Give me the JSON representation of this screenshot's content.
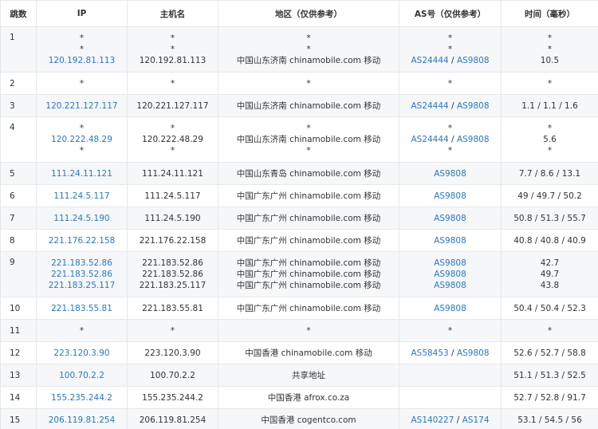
{
  "headers": {
    "hop": "跳数",
    "ip": "IP",
    "host": "主机名",
    "region": "地区（仅供参考）",
    "as": "AS号（仅供参考）",
    "time": "时间（毫秒）"
  },
  "rows": [
    {
      "hop": "1",
      "ip": [
        "*",
        "*",
        "120.192.81.113"
      ],
      "host": [
        "*",
        "*",
        "120.192.81.113"
      ],
      "region": [
        "*",
        "*",
        "中国山东济南 chinamobile.com 移动"
      ],
      "as": [
        [
          "*"
        ],
        [
          "*"
        ],
        [
          "AS24444",
          "AS9808"
        ]
      ],
      "time": [
        "*",
        "*",
        "10.5"
      ]
    },
    {
      "hop": "2",
      "ip": [
        "*"
      ],
      "host": [
        "*"
      ],
      "region": [
        "*"
      ],
      "as": [
        [
          "*"
        ]
      ],
      "time": [
        "*"
      ]
    },
    {
      "hop": "3",
      "ip": [
        "120.221.127.117"
      ],
      "host": [
        "120.221.127.117"
      ],
      "region": [
        "中国山东济南 chinamobile.com 移动"
      ],
      "as": [
        [
          "AS24444",
          "AS9808"
        ]
      ],
      "time": [
        "1.1 / 1.1 / 1.6"
      ]
    },
    {
      "hop": "4",
      "ip": [
        "*",
        "120.222.48.29",
        "*"
      ],
      "host": [
        "*",
        "120.222.48.29",
        "*"
      ],
      "region": [
        "*",
        "中国山东济南 chinamobile.com 移动",
        "*"
      ],
      "as": [
        [
          "*"
        ],
        [
          "AS24444",
          "AS9808"
        ],
        [
          "*"
        ]
      ],
      "time": [
        "*",
        "5.6",
        "*"
      ]
    },
    {
      "hop": "5",
      "ip": [
        "111.24.11.121"
      ],
      "host": [
        "111.24.11.121"
      ],
      "region": [
        "中国山东青岛 chinamobile.com 移动"
      ],
      "as": [
        [
          "AS9808"
        ]
      ],
      "time": [
        "7.7 / 8.6 / 13.1"
      ]
    },
    {
      "hop": "6",
      "ip": [
        "111.24.5.117"
      ],
      "host": [
        "111.24.5.117"
      ],
      "region": [
        "中国广东广州 chinamobile.com 移动"
      ],
      "as": [
        [
          "AS9808"
        ]
      ],
      "time": [
        "49 / 49.7 / 50.2"
      ]
    },
    {
      "hop": "7",
      "ip": [
        "111.24.5.190"
      ],
      "host": [
        "111.24.5.190"
      ],
      "region": [
        "中国广东广州 chinamobile.com 移动"
      ],
      "as": [
        [
          "AS9808"
        ]
      ],
      "time": [
        "50.8 / 51.3 / 55.7"
      ]
    },
    {
      "hop": "8",
      "ip": [
        "221.176.22.158"
      ],
      "host": [
        "221.176.22.158"
      ],
      "region": [
        "中国广东广州 chinamobile.com 移动"
      ],
      "as": [
        [
          "AS9808"
        ]
      ],
      "time": [
        "40.8 / 40.8 / 40.9"
      ]
    },
    {
      "hop": "9",
      "ip": [
        "221.183.52.86",
        "221.183.52.86",
        "221.183.25.117"
      ],
      "host": [
        "221.183.52.86",
        "221.183.52.86",
        "221.183.25.117"
      ],
      "region": [
        "中国广东广州 chinamobile.com 移动",
        "中国广东广州 chinamobile.com 移动",
        "中国广东广州 chinamobile.com 移动"
      ],
      "as": [
        [
          "AS9808"
        ],
        [
          "AS9808"
        ],
        [
          "AS9808"
        ]
      ],
      "time": [
        "42.7",
        "49.7",
        "43.8"
      ]
    },
    {
      "hop": "10",
      "ip": [
        "221.183.55.81"
      ],
      "host": [
        "221.183.55.81"
      ],
      "region": [
        "中国广东广州 chinamobile.com 移动"
      ],
      "as": [
        [
          "AS9808"
        ]
      ],
      "time": [
        "50.4 / 50.4 / 52.3"
      ]
    },
    {
      "hop": "11",
      "ip": [
        "*"
      ],
      "host": [
        "*"
      ],
      "region": [
        "*"
      ],
      "as": [
        [
          "*"
        ]
      ],
      "time": [
        "*"
      ]
    },
    {
      "hop": "12",
      "ip": [
        "223.120.3.90"
      ],
      "host": [
        "223.120.3.90"
      ],
      "region": [
        "中国香港 chinamobile.com 移动"
      ],
      "as": [
        [
          "AS58453",
          "AS9808"
        ]
      ],
      "time": [
        "52.6 / 52.7 / 58.8"
      ]
    },
    {
      "hop": "13",
      "ip": [
        "100.70.2.2"
      ],
      "host": [
        "100.70.2.2"
      ],
      "region": [
        "共享地址"
      ],
      "as": [
        []
      ],
      "time": [
        "51.1 / 51.3 / 52.5"
      ]
    },
    {
      "hop": "14",
      "ip": [
        "155.235.244.2"
      ],
      "host": [
        "155.235.244.2"
      ],
      "region": [
        "中国香港 afrox.co.za"
      ],
      "as": [
        []
      ],
      "time": [
        "52.7 / 52.8 / 91.7"
      ]
    },
    {
      "hop": "15",
      "ip": [
        "206.119.81.254"
      ],
      "host": [
        "206.119.81.254"
      ],
      "region": [
        "中国香港 cogentco.com"
      ],
      "as": [
        [
          "AS140227",
          "AS174"
        ]
      ],
      "time": [
        "53.1 / 54.5 / 56"
      ]
    }
  ]
}
